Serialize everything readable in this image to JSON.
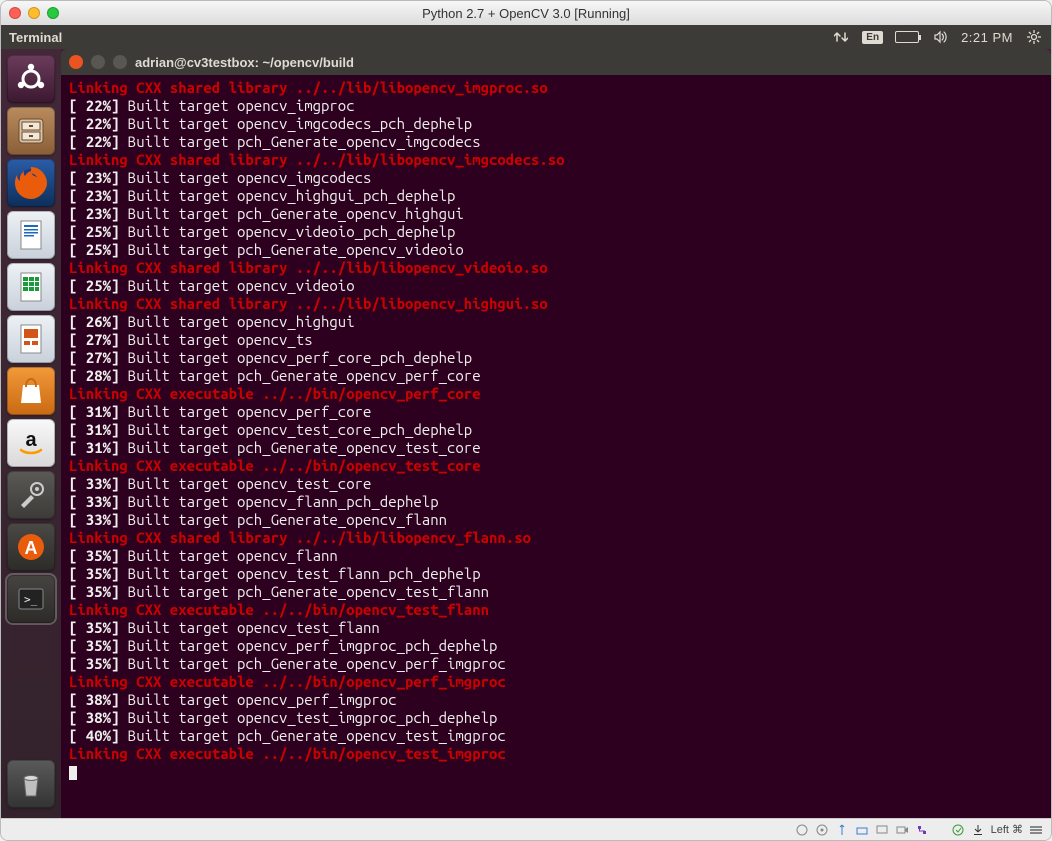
{
  "window": {
    "title": "Python 2.7 + OpenCV 3.0 [Running]"
  },
  "panel": {
    "app": "Terminal",
    "lang": "En",
    "time": "2:21 PM"
  },
  "terminal": {
    "title": "adrian@cv3testbox: ~/opencv/build",
    "lines": [
      {
        "type": "link",
        "text": "Linking CXX shared library ../../lib/libopencv_imgproc.so"
      },
      {
        "type": "built",
        "percent": "22%",
        "text": "Built target opencv_imgproc"
      },
      {
        "type": "built",
        "percent": "22%",
        "text": "Built target opencv_imgcodecs_pch_dephelp"
      },
      {
        "type": "built",
        "percent": "22%",
        "text": "Built target pch_Generate_opencv_imgcodecs"
      },
      {
        "type": "link",
        "text": "Linking CXX shared library ../../lib/libopencv_imgcodecs.so"
      },
      {
        "type": "built",
        "percent": "23%",
        "text": "Built target opencv_imgcodecs"
      },
      {
        "type": "built",
        "percent": "23%",
        "text": "Built target opencv_highgui_pch_dephelp"
      },
      {
        "type": "built",
        "percent": "23%",
        "text": "Built target pch_Generate_opencv_highgui"
      },
      {
        "type": "built",
        "percent": "25%",
        "text": "Built target opencv_videoio_pch_dephelp"
      },
      {
        "type": "built",
        "percent": "25%",
        "text": "Built target pch_Generate_opencv_videoio"
      },
      {
        "type": "link",
        "text": "Linking CXX shared library ../../lib/libopencv_videoio.so"
      },
      {
        "type": "built",
        "percent": "25%",
        "text": "Built target opencv_videoio"
      },
      {
        "type": "link",
        "text": "Linking CXX shared library ../../lib/libopencv_highgui.so"
      },
      {
        "type": "built",
        "percent": "26%",
        "text": "Built target opencv_highgui"
      },
      {
        "type": "built",
        "percent": "27%",
        "text": "Built target opencv_ts"
      },
      {
        "type": "built",
        "percent": "27%",
        "text": "Built target opencv_perf_core_pch_dephelp"
      },
      {
        "type": "built",
        "percent": "28%",
        "text": "Built target pch_Generate_opencv_perf_core"
      },
      {
        "type": "link",
        "text": "Linking CXX executable ../../bin/opencv_perf_core"
      },
      {
        "type": "built",
        "percent": "31%",
        "text": "Built target opencv_perf_core"
      },
      {
        "type": "built",
        "percent": "31%",
        "text": "Built target opencv_test_core_pch_dephelp"
      },
      {
        "type": "built",
        "percent": "31%",
        "text": "Built target pch_Generate_opencv_test_core"
      },
      {
        "type": "link",
        "text": "Linking CXX executable ../../bin/opencv_test_core"
      },
      {
        "type": "built",
        "percent": "33%",
        "text": "Built target opencv_test_core"
      },
      {
        "type": "built",
        "percent": "33%",
        "text": "Built target opencv_flann_pch_dephelp"
      },
      {
        "type": "built",
        "percent": "33%",
        "text": "Built target pch_Generate_opencv_flann"
      },
      {
        "type": "link",
        "text": "Linking CXX shared library ../../lib/libopencv_flann.so"
      },
      {
        "type": "built",
        "percent": "35%",
        "text": "Built target opencv_flann"
      },
      {
        "type": "built",
        "percent": "35%",
        "text": "Built target opencv_test_flann_pch_dephelp"
      },
      {
        "type": "built",
        "percent": "35%",
        "text": "Built target pch_Generate_opencv_test_flann"
      },
      {
        "type": "link",
        "text": "Linking CXX executable ../../bin/opencv_test_flann"
      },
      {
        "type": "built",
        "percent": "35%",
        "text": "Built target opencv_test_flann"
      },
      {
        "type": "built",
        "percent": "35%",
        "text": "Built target opencv_perf_imgproc_pch_dephelp"
      },
      {
        "type": "built",
        "percent": "35%",
        "text": "Built target pch_Generate_opencv_perf_imgproc"
      },
      {
        "type": "link",
        "text": "Linking CXX executable ../../bin/opencv_perf_imgproc"
      },
      {
        "type": "built",
        "percent": "38%",
        "text": "Built target opencv_perf_imgproc"
      },
      {
        "type": "built",
        "percent": "38%",
        "text": "Built target opencv_test_imgproc_pch_dephelp"
      },
      {
        "type": "built",
        "percent": "40%",
        "text": "Built target pch_Generate_opencv_test_imgproc"
      },
      {
        "type": "link",
        "text": "Linking CXX executable ../../bin/opencv_test_imgproc"
      }
    ]
  },
  "statusbar": {
    "hostkey": "Left ⌘"
  },
  "launcher": {
    "items": [
      "dash",
      "files",
      "firefox",
      "writer",
      "calc",
      "impress",
      "software-center",
      "amazon",
      "settings",
      "software-updater",
      "terminal"
    ]
  }
}
